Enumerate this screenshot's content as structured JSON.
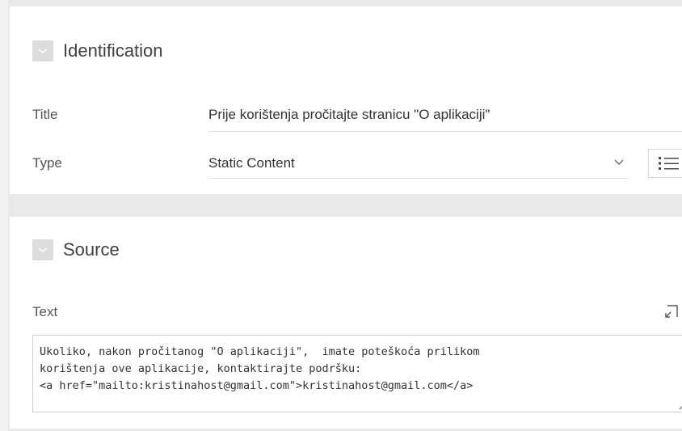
{
  "identification": {
    "title": "Identification",
    "title_label": "Title",
    "title_value": "Prije korištenja pročitajte stranicu \"O aplikaciji\"",
    "type_label": "Type",
    "type_value": "Static Content"
  },
  "source": {
    "title": "Source",
    "text_label": "Text",
    "text_lines": [
      "Ukoliko, nakon pročitanog \"O aplikaciji\",  imate poteškoća prilikom",
      "korištenja ove aplikacije, kontaktirajte podršku:",
      "<a href=\"mailto:kristinahost@gmail.com\">kristinahost@gmail.com</a>"
    ]
  },
  "icons": {
    "collapse": "chevron-down-icon",
    "list": "list-icon",
    "expand": "expand-icon",
    "resize": "resize-grip-icon"
  },
  "colors": {
    "panel_bg": "#ffffff",
    "page_bg": "#e9e9e9",
    "button_bg": "#dcdcdc"
  }
}
